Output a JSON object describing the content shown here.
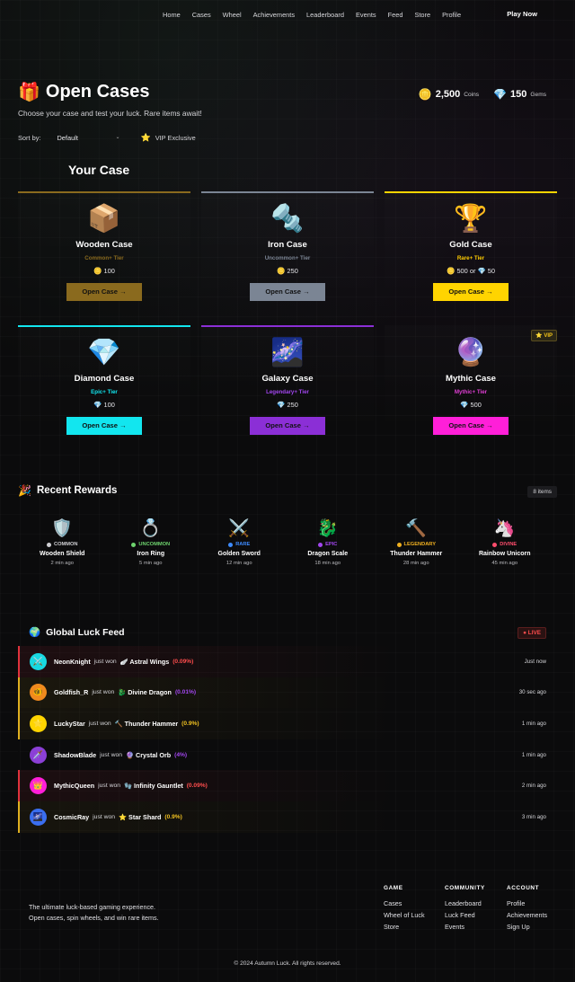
{
  "nav": {
    "links": [
      "Home",
      "Cases",
      "Wheel",
      "Achievements",
      "Leaderboard",
      "Events",
      "Feed",
      "Store",
      "Profile"
    ],
    "cta": "Play Now"
  },
  "header": {
    "title_icon": "🎁",
    "title": "Open Cases",
    "subtitle": "Choose your case and test your luck. Rare items await!"
  },
  "balances": {
    "coins": {
      "icon": "🪙",
      "value": "2,500",
      "label": "Coins"
    },
    "gems": {
      "icon": "💎",
      "value": "150",
      "label": "Gems"
    }
  },
  "sort": {
    "label": "Sort by:",
    "selected": "Default",
    "vip_icon": "⭐",
    "vip_label": "VIP Exclusive"
  },
  "section_title": "Your Case",
  "cases": [
    {
      "icon": "📦",
      "name": "Wooden Case",
      "tier": "Common+ Tier",
      "price_icon": "🪙",
      "price": "100",
      "button": "Open Case  →",
      "color": "#8a6a1e",
      "tier_color": "#8a6a1e",
      "vip": false
    },
    {
      "icon": "🔩",
      "name": "Iron Case",
      "tier": "Uncommon+ Tier",
      "price_icon": "🪙",
      "price": "250",
      "button": "Open Case  →",
      "color": "#7b8594",
      "tier_color": "#7b8594",
      "vip": false
    },
    {
      "icon": "🏆",
      "name": "Gold Case",
      "tier": "Rare+ Tier",
      "price_icon": "🪙",
      "price": "500 or 💎 50",
      "button": "Open Case  →",
      "color": "#ffd400",
      "tier_color": "#ffcc00",
      "vip": false
    },
    {
      "icon": "💎",
      "name": "Diamond Case",
      "tier": "Epic+ Tier",
      "price_icon": "💎",
      "price": "100",
      "button": "Open Case  →",
      "color": "#12e6ef",
      "tier_color": "#12e6ef",
      "vip": false
    },
    {
      "icon": "🌌",
      "name": "Galaxy Case",
      "tier": "Legendary+ Tier",
      "price_icon": "💎",
      "price": "250",
      "button": "Open Case  →",
      "color": "#8b2fd6",
      "tier_color": "#a346f0",
      "vip": false
    },
    {
      "icon": "🔮",
      "name": "Mythic Case",
      "tier": "Mythic+ Tier",
      "price_icon": "💎",
      "price": "500",
      "button": "Open Case  →",
      "color": "#ff1fd8",
      "tier_color": "#e23fd6",
      "vip": true,
      "vip_label": "⭐ VIP"
    }
  ],
  "recent": {
    "icon": "🎉",
    "title": "Recent Rewards",
    "count": "8 items",
    "items": [
      {
        "icon": "🛡️",
        "rarity": "COMMON",
        "rarity_color": "#cfcfd3",
        "name": "Wooden Shield",
        "time": "2 min ago"
      },
      {
        "icon": "💍",
        "rarity": "UNCOMMON",
        "rarity_color": "#6ed36e",
        "name": "Iron Ring",
        "time": "5 min ago"
      },
      {
        "icon": "⚔️",
        "rarity": "RARE",
        "rarity_color": "#3d8bff",
        "name": "Golden Sword",
        "time": "12 min ago"
      },
      {
        "icon": "🐉",
        "rarity": "EPIC",
        "rarity_color": "#a346f0",
        "name": "Dragon Scale",
        "time": "18 min ago"
      },
      {
        "icon": "🔨",
        "rarity": "LEGENDARY",
        "rarity_color": "#f0b020",
        "name": "Thunder Hammer",
        "time": "28 min ago"
      },
      {
        "icon": "🦄",
        "rarity": "DIVINE",
        "rarity_color": "#ff4d6d",
        "name": "Rainbow Unicorn",
        "time": "45 min ago"
      }
    ]
  },
  "feed": {
    "icon": "🌍",
    "title": "Global Luck Feed",
    "live": "● LIVE",
    "rows": [
      {
        "avatar": "⚔️",
        "avatar_bg": "#18d8e0",
        "user": "NeonKnight",
        "verb": "just won",
        "item": "🪽 Astral Wings",
        "pct": "(0.09%)",
        "pct_color": "#ff4d4d",
        "time": "Just now",
        "bar": "#e0323c",
        "glow": "rgba(120,30,40,0.18)"
      },
      {
        "avatar": "🐠",
        "avatar_bg": "#f08a1e",
        "user": "Goldfish_R",
        "verb": "just won",
        "item": "🐉 Divine Dragon",
        "pct": "(0.01%)",
        "pct_color": "#a346f0",
        "time": "30 sec ago",
        "bar": "#e0b020",
        "glow": "rgba(110,90,20,0.16)"
      },
      {
        "avatar": "⭐",
        "avatar_bg": "#ffd400",
        "user": "LuckyStar",
        "verb": "just won",
        "item": "🔨 Thunder Hammer",
        "pct": "(0.9%)",
        "pct_color": "#f0c020",
        "time": "1 min ago",
        "bar": "#e0b020",
        "glow": "rgba(110,90,20,0.12)"
      },
      {
        "avatar": "🗡️",
        "avatar_bg": "#8b3fd6",
        "user": "ShadowBlade",
        "verb": "just won",
        "item": "🔮 Crystal Orb",
        "pct": "(4%)",
        "pct_color": "#a346f0",
        "time": "1 min ago",
        "bar": "#0b0b0c",
        "glow": "rgba(0,0,0,0)"
      },
      {
        "avatar": "👑",
        "avatar_bg": "#ff1fd8",
        "user": "MythicQueen",
        "verb": "just won",
        "item": "🧤 Infinity Gauntlet",
        "pct": "(0.09%)",
        "pct_color": "#ff4d4d",
        "time": "2 min ago",
        "bar": "#e0323c",
        "glow": "rgba(120,30,40,0.16)"
      },
      {
        "avatar": "🌌",
        "avatar_bg": "#3a6ef0",
        "user": "CosmicRay",
        "verb": "just won",
        "item": "⭐ Star Shard",
        "pct": "(0.9%)",
        "pct_color": "#f0c020",
        "time": "3 min ago",
        "bar": "#e0b020",
        "glow": "rgba(110,90,20,0.12)"
      }
    ]
  },
  "footer": {
    "desc": "The ultimate luck-based gaming experience. Open cases, spin wheels, and win rare items.",
    "columns": [
      {
        "title": "GAME",
        "links": [
          "Cases",
          "Wheel of Luck",
          "Store"
        ]
      },
      {
        "title": "COMMUNITY",
        "links": [
          "Leaderboard",
          "Luck Feed",
          "Events"
        ]
      },
      {
        "title": "ACCOUNT",
        "links": [
          "Profile",
          "Achievements",
          "Sign Up"
        ]
      }
    ],
    "copyright": "© 2024 Autumn Luck. All rights reserved."
  }
}
